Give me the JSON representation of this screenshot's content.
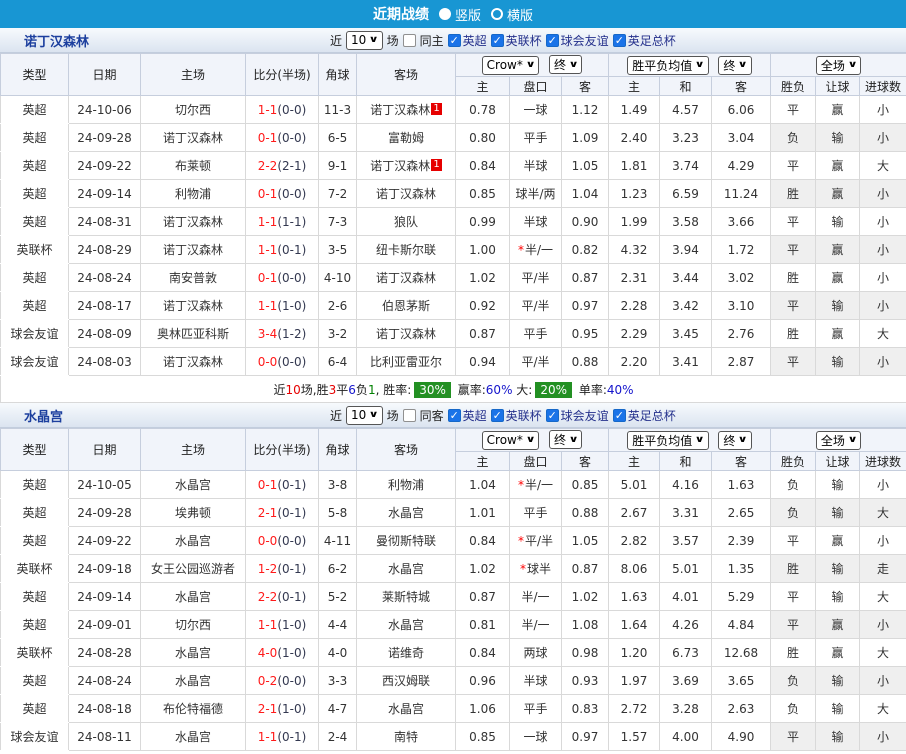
{
  "colors": {
    "topbar_bg": "#1896d3",
    "league_epl_red": "#f5413d",
    "league_cup_gray": "#8f8f8f",
    "league_friendly_teal": "#28a3a0",
    "focus_team_green": "#009933",
    "score_red": "#ff1a1a",
    "handicap_blue": "#0a6fc2",
    "win_red": "#e60000",
    "draw_blue": "#1414cc",
    "loss_green": "#008000",
    "summary_badge_green": "#239023",
    "odds_cell_bg": "#fdf8f2",
    "avg_cell_bg": "#eaf4fb"
  },
  "topbar": {
    "title": "近期战绩",
    "radio_vertical": "竖版",
    "radio_horizontal": "横版"
  },
  "sections": [
    {
      "team": "诺丁汉森林",
      "filter": {
        "near": "近",
        "count": "10",
        "games": "场",
        "same": "同主",
        "same_checked": false,
        "leagues": [
          {
            "label": "英超",
            "checked": true
          },
          {
            "label": "英联杯",
            "checked": true
          },
          {
            "label": "球会友谊",
            "checked": true
          },
          {
            "label": "英足总杯",
            "checked": true
          }
        ]
      },
      "header": {
        "type": "类型",
        "date": "日期",
        "home": "主场",
        "score": "比分(半场)",
        "corner": "角球",
        "away": "客场",
        "odds_source": "Crow*",
        "odds_final": "终",
        "avg_source": "胜平负均值",
        "avg_final": "终",
        "scope": "全场",
        "sub": [
          "主",
          "盘口",
          "客",
          "主",
          "和",
          "客",
          "胜负",
          "让球",
          "进球数"
        ]
      },
      "rows": [
        {
          "league": "英超",
          "lc": "red",
          "date": "24-10-06",
          "home": "切尔西",
          "hf": false,
          "ft": "1-1",
          "ht": "(0-0)",
          "corner": "11-3",
          "away": "诺丁汉森林",
          "af": true,
          "badge": "1",
          "o1": "0.78",
          "star": false,
          "hcap": "一球",
          "o2": "1.12",
          "a1": "1.49",
          "a2": "4.57",
          "a3": "6.06",
          "r1": "平",
          "c1": "blue",
          "r2": "赢",
          "c2": "red",
          "r3": "小",
          "c3": "green"
        },
        {
          "league": "英超",
          "lc": "red",
          "date": "24-09-28",
          "home": "诺丁汉森林",
          "hf": true,
          "ft": "0-1",
          "ht": "(0-0)",
          "corner": "6-5",
          "away": "富勒姆",
          "af": false,
          "badge": "",
          "o1": "0.80",
          "star": false,
          "hcap": "平手",
          "o2": "1.09",
          "a1": "2.40",
          "a2": "3.23",
          "a3": "3.04",
          "r1": "负",
          "c1": "green",
          "r2": "输",
          "c2": "green",
          "r3": "小",
          "c3": "green"
        },
        {
          "league": "英超",
          "lc": "red",
          "date": "24-09-22",
          "home": "布莱顿",
          "hf": false,
          "ft": "2-2",
          "ht": "(2-1)",
          "corner": "9-1",
          "away": "诺丁汉森林",
          "af": true,
          "badge": "1",
          "o1": "0.84",
          "star": false,
          "hcap": "半球",
          "o2": "1.05",
          "a1": "1.81",
          "a2": "3.74",
          "a3": "4.29",
          "r1": "平",
          "c1": "blue",
          "r2": "赢",
          "c2": "red",
          "r3": "大",
          "c3": "red"
        },
        {
          "league": "英超",
          "lc": "red",
          "date": "24-09-14",
          "home": "利物浦",
          "hf": false,
          "ft": "0-1",
          "ht": "(0-0)",
          "corner": "7-2",
          "away": "诺丁汉森林",
          "af": true,
          "badge": "",
          "o1": "0.85",
          "star": false,
          "hcap": "球半/两",
          "o2": "1.04",
          "a1": "1.23",
          "a2": "6.59",
          "a3": "11.24",
          "r1": "胜",
          "c1": "red",
          "r2": "赢",
          "c2": "red",
          "r3": "小",
          "c3": "green"
        },
        {
          "league": "英超",
          "lc": "red",
          "date": "24-08-31",
          "home": "诺丁汉森林",
          "hf": true,
          "ft": "1-1",
          "ht": "(1-1)",
          "corner": "7-3",
          "away": "狼队",
          "af": false,
          "badge": "",
          "o1": "0.99",
          "star": false,
          "hcap": "半球",
          "o2": "0.90",
          "a1": "1.99",
          "a2": "3.58",
          "a3": "3.66",
          "r1": "平",
          "c1": "blue",
          "r2": "输",
          "c2": "green",
          "r3": "小",
          "c3": "green"
        },
        {
          "league": "英联杯",
          "lc": "gray",
          "date": "24-08-29",
          "home": "诺丁汉森林",
          "hf": true,
          "ft": "1-1",
          "ht": "(0-1)",
          "corner": "3-5",
          "away": "纽卡斯尔联",
          "af": false,
          "badge": "",
          "o1": "1.00",
          "star": true,
          "hcap": "半/一",
          "o2": "0.82",
          "a1": "4.32",
          "a2": "3.94",
          "a3": "1.72",
          "r1": "平",
          "c1": "blue",
          "r2": "赢",
          "c2": "red",
          "r3": "小",
          "c3": "green"
        },
        {
          "league": "英超",
          "lc": "red",
          "date": "24-08-24",
          "home": "南安普敦",
          "hf": false,
          "ft": "0-1",
          "ht": "(0-0)",
          "corner": "4-10",
          "away": "诺丁汉森林",
          "af": true,
          "badge": "",
          "o1": "1.02",
          "star": false,
          "hcap": "平/半",
          "o2": "0.87",
          "a1": "2.31",
          "a2": "3.44",
          "a3": "3.02",
          "r1": "胜",
          "c1": "red",
          "r2": "赢",
          "c2": "red",
          "r3": "小",
          "c3": "green"
        },
        {
          "league": "英超",
          "lc": "red",
          "date": "24-08-17",
          "home": "诺丁汉森林",
          "hf": true,
          "ft": "1-1",
          "ht": "(1-0)",
          "corner": "2-6",
          "away": "伯恩茅斯",
          "af": false,
          "badge": "",
          "o1": "0.92",
          "star": false,
          "hcap": "平/半",
          "o2": "0.97",
          "a1": "2.28",
          "a2": "3.42",
          "a3": "3.10",
          "r1": "平",
          "c1": "blue",
          "r2": "输",
          "c2": "green",
          "r3": "小",
          "c3": "green"
        },
        {
          "league": "球会友谊",
          "lc": "teal",
          "date": "24-08-09",
          "home": "奥林匹亚科斯",
          "hf": false,
          "ft": "3-4",
          "ht": "(1-2)",
          "corner": "3-2",
          "away": "诺丁汉森林",
          "af": true,
          "badge": "",
          "o1": "0.87",
          "star": false,
          "hcap": "平手",
          "o2": "0.95",
          "a1": "2.29",
          "a2": "3.45",
          "a3": "2.76",
          "r1": "胜",
          "c1": "red",
          "r2": "赢",
          "c2": "red",
          "r3": "大",
          "c3": "red"
        },
        {
          "league": "球会友谊",
          "lc": "teal",
          "date": "24-08-03",
          "home": "诺丁汉森林",
          "hf": true,
          "ft": "0-0",
          "ht": "(0-0)",
          "corner": "6-4",
          "away": "比利亚雷亚尔",
          "af": false,
          "badge": "",
          "o1": "0.94",
          "star": false,
          "hcap": "平/半",
          "o2": "0.88",
          "a1": "2.20",
          "a2": "3.41",
          "a3": "2.87",
          "r1": "平",
          "c1": "blue",
          "r2": "输",
          "c2": "green",
          "r3": "小",
          "c3": "green"
        }
      ],
      "summary": [
        {
          "t": "近"
        },
        {
          "t": "10",
          "c": "red"
        },
        {
          "t": "场,胜"
        },
        {
          "t": "3",
          "c": "red"
        },
        {
          "t": "平"
        },
        {
          "t": "6",
          "c": "blue"
        },
        {
          "t": "负"
        },
        {
          "t": "1",
          "c": "green"
        },
        {
          "t": ", 胜率:"
        },
        {
          "t": "30%",
          "b": true
        },
        {
          "t": " 赢率:"
        },
        {
          "t": "60%",
          "c": "blue"
        },
        {
          "t": " 大:"
        },
        {
          "t": "20%",
          "b": true
        },
        {
          "t": " 单率:"
        },
        {
          "t": "40%",
          "c": "blue"
        }
      ]
    },
    {
      "team": "水晶宫",
      "filter": {
        "near": "近",
        "count": "10",
        "games": "场",
        "same": "同客",
        "same_checked": false,
        "leagues": [
          {
            "label": "英超",
            "checked": true
          },
          {
            "label": "英联杯",
            "checked": true
          },
          {
            "label": "球会友谊",
            "checked": true
          },
          {
            "label": "英足总杯",
            "checked": true
          }
        ]
      },
      "header": {
        "type": "类型",
        "date": "日期",
        "home": "主场",
        "score": "比分(半场)",
        "corner": "角球",
        "away": "客场",
        "odds_source": "Crow*",
        "odds_final": "终",
        "avg_source": "胜平负均值",
        "avg_final": "终",
        "scope": "全场",
        "sub": [
          "主",
          "盘口",
          "客",
          "主",
          "和",
          "客",
          "胜负",
          "让球",
          "进球数"
        ]
      },
      "rows": [
        {
          "league": "英超",
          "lc": "red",
          "date": "24-10-05",
          "home": "水晶宫",
          "hf": true,
          "ft": "0-1",
          "ht": "(0-1)",
          "corner": "3-8",
          "away": "利物浦",
          "af": false,
          "badge": "",
          "o1": "1.04",
          "star": true,
          "hcap": "半/一",
          "o2": "0.85",
          "a1": "5.01",
          "a2": "4.16",
          "a3": "1.63",
          "r1": "负",
          "c1": "green",
          "r2": "输",
          "c2": "green",
          "r3": "小",
          "c3": "green"
        },
        {
          "league": "英超",
          "lc": "red",
          "date": "24-09-28",
          "home": "埃弗顿",
          "hf": false,
          "ft": "2-1",
          "ht": "(0-1)",
          "corner": "5-8",
          "away": "水晶宫",
          "af": true,
          "badge": "",
          "o1": "1.01",
          "star": false,
          "hcap": "平手",
          "o2": "0.88",
          "a1": "2.67",
          "a2": "3.31",
          "a3": "2.65",
          "r1": "负",
          "c1": "green",
          "r2": "输",
          "c2": "green",
          "r3": "大",
          "c3": "red"
        },
        {
          "league": "英超",
          "lc": "red",
          "date": "24-09-22",
          "home": "水晶宫",
          "hf": true,
          "ft": "0-0",
          "ht": "(0-0)",
          "corner": "4-11",
          "away": "曼彻斯特联",
          "af": false,
          "badge": "",
          "o1": "0.84",
          "star": true,
          "hcap": "平/半",
          "o2": "1.05",
          "a1": "2.82",
          "a2": "3.57",
          "a3": "2.39",
          "r1": "平",
          "c1": "blue",
          "r2": "赢",
          "c2": "red",
          "r3": "小",
          "c3": "green"
        },
        {
          "league": "英联杯",
          "lc": "gray",
          "date": "24-09-18",
          "home": "女王公园巡游者",
          "hf": false,
          "ft": "1-2",
          "ht": "(0-1)",
          "corner": "6-2",
          "away": "水晶宫",
          "af": true,
          "badge": "",
          "o1": "1.02",
          "star": true,
          "hcap": "球半",
          "o2": "0.87",
          "a1": "8.06",
          "a2": "5.01",
          "a3": "1.35",
          "r1": "胜",
          "c1": "red",
          "r2": "输",
          "c2": "green",
          "r3": "走",
          "c3": "blue"
        },
        {
          "league": "英超",
          "lc": "red",
          "date": "24-09-14",
          "home": "水晶宫",
          "hf": true,
          "ft": "2-2",
          "ht": "(0-1)",
          "corner": "5-2",
          "away": "莱斯特城",
          "af": false,
          "badge": "",
          "o1": "0.87",
          "star": false,
          "hcap": "半/一",
          "o2": "1.02",
          "a1": "1.63",
          "a2": "4.01",
          "a3": "5.29",
          "r1": "平",
          "c1": "blue",
          "r2": "输",
          "c2": "green",
          "r3": "大",
          "c3": "red"
        },
        {
          "league": "英超",
          "lc": "red",
          "date": "24-09-01",
          "home": "切尔西",
          "hf": false,
          "ft": "1-1",
          "ht": "(1-0)",
          "corner": "4-4",
          "away": "水晶宫",
          "af": true,
          "badge": "",
          "o1": "0.81",
          "star": false,
          "hcap": "半/一",
          "o2": "1.08",
          "a1": "1.64",
          "a2": "4.26",
          "a3": "4.84",
          "r1": "平",
          "c1": "blue",
          "r2": "赢",
          "c2": "red",
          "r3": "小",
          "c3": "green"
        },
        {
          "league": "英联杯",
          "lc": "gray",
          "date": "24-08-28",
          "home": "水晶宫",
          "hf": true,
          "ft": "4-0",
          "ht": "(1-0)",
          "corner": "4-0",
          "away": "诺维奇",
          "af": false,
          "badge": "",
          "o1": "0.84",
          "star": false,
          "hcap": "两球",
          "o2": "0.98",
          "a1": "1.20",
          "a2": "6.73",
          "a3": "12.68",
          "r1": "胜",
          "c1": "red",
          "r2": "赢",
          "c2": "red",
          "r3": "大",
          "c3": "red"
        },
        {
          "league": "英超",
          "lc": "red",
          "date": "24-08-24",
          "home": "水晶宫",
          "hf": true,
          "ft": "0-2",
          "ht": "(0-0)",
          "corner": "3-3",
          "away": "西汉姆联",
          "af": false,
          "badge": "",
          "o1": "0.96",
          "star": false,
          "hcap": "半球",
          "o2": "0.93",
          "a1": "1.97",
          "a2": "3.69",
          "a3": "3.65",
          "r1": "负",
          "c1": "green",
          "r2": "输",
          "c2": "green",
          "r3": "小",
          "c3": "green"
        },
        {
          "league": "英超",
          "lc": "red",
          "date": "24-08-18",
          "home": "布伦特福德",
          "hf": false,
          "ft": "2-1",
          "ht": "(1-0)",
          "corner": "4-7",
          "away": "水晶宫",
          "af": true,
          "badge": "",
          "o1": "1.06",
          "star": false,
          "hcap": "平手",
          "o2": "0.83",
          "a1": "2.72",
          "a2": "3.28",
          "a3": "2.63",
          "r1": "负",
          "c1": "green",
          "r2": "输",
          "c2": "green",
          "r3": "大",
          "c3": "red"
        },
        {
          "league": "球会友谊",
          "lc": "teal",
          "date": "24-08-11",
          "home": "水晶宫",
          "hf": true,
          "ft": "1-1",
          "ht": "(0-1)",
          "corner": "2-4",
          "away": "南特",
          "af": false,
          "badge": "",
          "o1": "0.85",
          "star": false,
          "hcap": "一球",
          "o2": "0.97",
          "a1": "1.57",
          "a2": "4.00",
          "a3": "4.90",
          "r1": "平",
          "c1": "blue",
          "r2": "输",
          "c2": "green",
          "r3": "小",
          "c3": "green"
        }
      ]
    }
  ]
}
